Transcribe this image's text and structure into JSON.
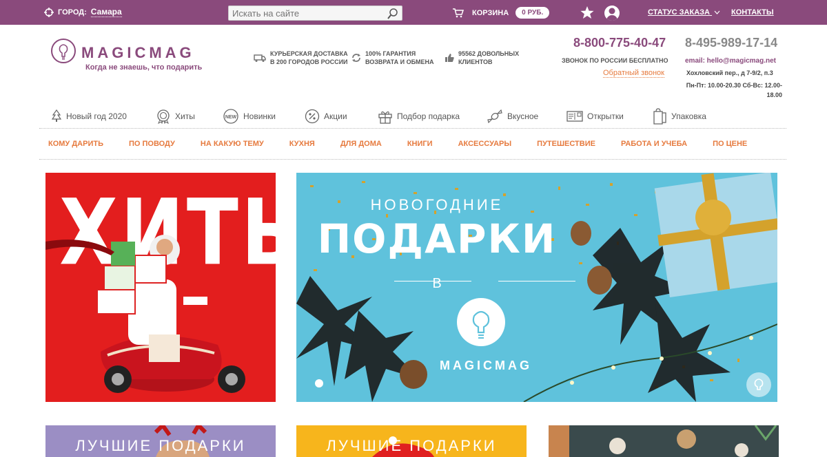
{
  "topbar": {
    "city_label": "ГОРОД:",
    "city_value": "Самара",
    "search_placeholder": "Искать на сайте",
    "cart_label": "КОРЗИНА",
    "cart_price": "0 РУБ.",
    "order_status": "СТАТУС ЗАКАЗА",
    "contacts": "КОНТАКТЫ"
  },
  "header": {
    "brand": "MAGICMAG",
    "slogan": "Когда не знаешь, что подарить",
    "features": [
      {
        "line1": "КУРЬЕРСКАЯ ДОСТАВКА",
        "line2": "В 200 ГОРОДОВ РОССИИ"
      },
      {
        "line1": "100% ГАРАНТИЯ",
        "line2": "ВОЗВРАТА И ОБМЕНА"
      },
      {
        "line1": "95562 ДОВОЛЬНЫХ",
        "line2": "КЛИЕНТОВ"
      }
    ],
    "phone_free": "8-800-775-40-47",
    "phone_moscow": "8-495-989-17-14",
    "free_call_note": "ЗВОНОК ПО РОССИИ БЕСПЛАТНО",
    "callback": "Обратный звонок",
    "email": "email: hello@magicmag.net",
    "address": "Хохловский пер., д 7-9/2, п.3",
    "hours": "Пн-Пт: 10.00-20.30 Сб-Вс: 12.00-18.00"
  },
  "categories": [
    {
      "label": "Новый год 2020",
      "icon": "tree-icon"
    },
    {
      "label": "Хиты",
      "icon": "award-icon"
    },
    {
      "label": "Новинки",
      "icon": "new-badge-icon"
    },
    {
      "label": "Акции",
      "icon": "percent-icon"
    },
    {
      "label": "Подбор подарка",
      "icon": "gift-icon"
    },
    {
      "label": "Вкусное",
      "icon": "candy-icon"
    },
    {
      "label": "Открытки",
      "icon": "card-icon"
    },
    {
      "label": "Упаковка",
      "icon": "package-icon"
    }
  ],
  "menu": [
    "КОМУ ДАРИТЬ",
    "ПО ПОВОДУ",
    "НА КАКУЮ ТЕМУ",
    "КУХНЯ",
    "ДЛЯ ДОМА",
    "КНИГИ",
    "АКСЕССУАРЫ",
    "ПУТЕШЕСТВИЕ",
    "РАБОТА И УЧЕБА",
    "ПО ЦЕНЕ"
  ],
  "banners": {
    "left_title": "ХИТЫ",
    "main_line1": "НОВОГОДНИЕ",
    "main_line2": "ПОДАРКИ",
    "main_line3": "В",
    "main_brand": "MAGICMAG"
  },
  "tiles": [
    {
      "title": "ЛУЧШИЕ ПОДАРКИ",
      "color": "#9b8ec4"
    },
    {
      "title": "ЛУЧШИЕ ПОДАРКИ",
      "color": "#f7b51c"
    },
    {
      "title": "",
      "color": "#3a4a4c"
    }
  ],
  "colors": {
    "brand": "#8a4a7c",
    "accent": "#e67a3e",
    "banner_red": "#e31e1e",
    "banner_blue": "#5fc2dc"
  }
}
